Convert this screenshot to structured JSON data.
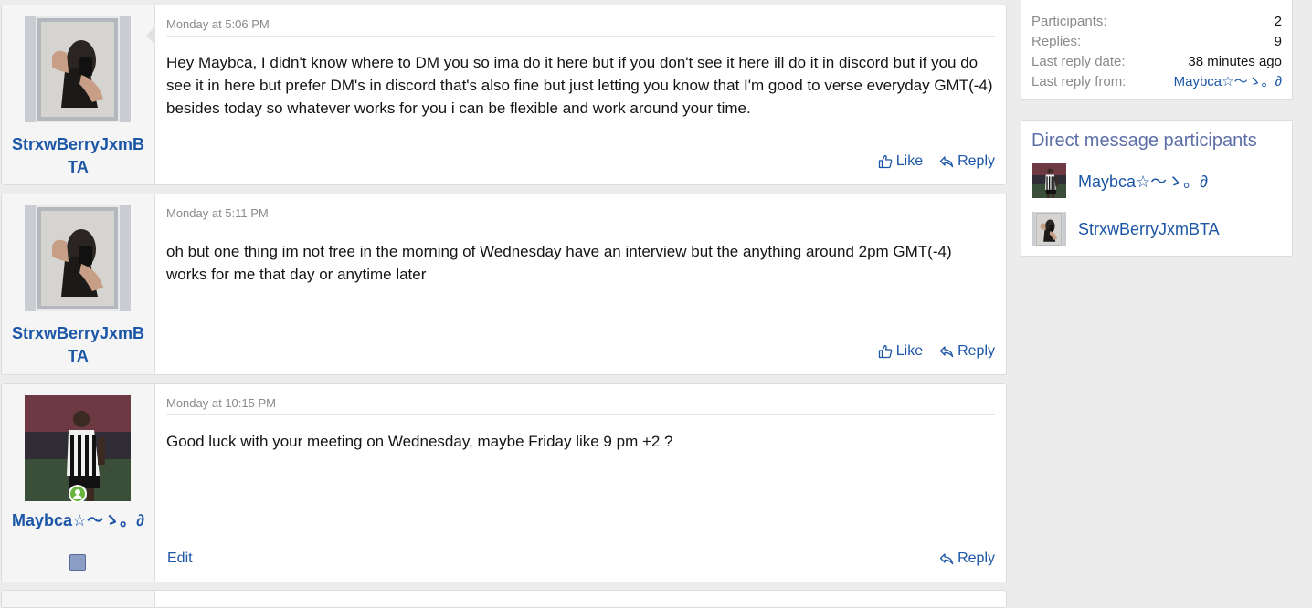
{
  "messages": [
    {
      "username": "StrxwBerryJxmBTA",
      "date": "Monday at 5:06 PM",
      "text": "Hey Maybca, I didn't know where to DM you so ima do it here but if you don't see it here ill do it in discord but if you do see it in here but prefer DM's in discord that's also fine but just letting you know that I'm good to verse everyday GMT(-4) besides today so whatever works for you i can be flexible and work around your time.",
      "like_label": "Like",
      "reply_label": "Reply"
    },
    {
      "username": "StrxwBerryJxmBTA",
      "date": "Monday at 5:11 PM",
      "text": "oh but one thing im not free in the morning of Wednesday have an interview but the anything around 2pm GMT(-4) works for me that day or anytime later",
      "like_label": "Like",
      "reply_label": "Reply"
    },
    {
      "username": "Maybca☆〜ゝ。∂",
      "date": "Monday at 10:15 PM",
      "text": "Good luck with your meeting on Wednesday, maybe Friday like 9 pm +2 ?",
      "edit_label": "Edit",
      "reply_label": "Reply"
    }
  ],
  "stats": {
    "participants_label": "Participants:",
    "participants_value": "2",
    "replies_label": "Replies:",
    "replies_value": "9",
    "last_reply_date_label": "Last reply date:",
    "last_reply_date_value": "38 minutes ago",
    "last_reply_from_label": "Last reply from:",
    "last_reply_from_value": "Maybca☆〜ゝ。∂"
  },
  "participants_box": {
    "title": "Direct message participants",
    "items": [
      {
        "name": "Maybca☆〜ゝ。∂"
      },
      {
        "name": "StrxwBerryJxmBTA"
      }
    ]
  },
  "colors": {
    "link": "#1c56a6",
    "page_bg": "#ececec",
    "sidebar_title": "#5e6fa7",
    "online": "#66b53c"
  }
}
